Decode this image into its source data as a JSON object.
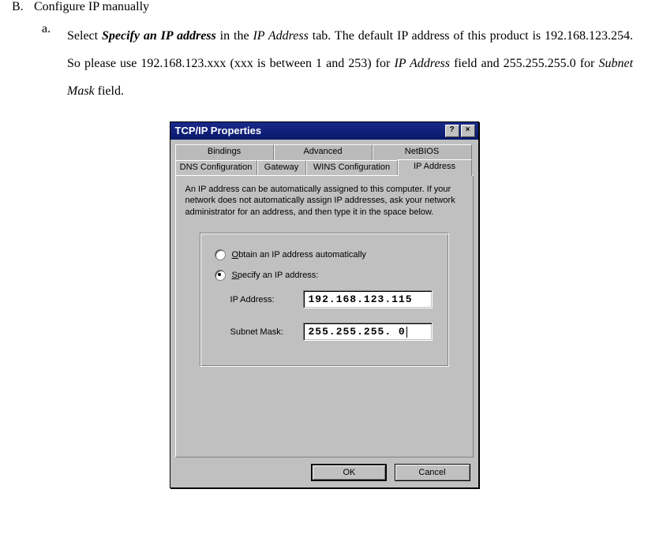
{
  "doc": {
    "section_b_marker": "B.",
    "section_b_title": "Configure IP manually",
    "sub_a_marker": "a.",
    "sub_a_pre": "Select ",
    "sub_a_strong": "Specify an IP address",
    "sub_a_mid1": " in the ",
    "sub_a_it1": "IP Address",
    "sub_a_mid2": " tab. The default IP address of this product is 192.168.123.254. So please use 192.168.123.xxx (xxx is between 1 and 253) for ",
    "sub_a_it2": "IP Address",
    "sub_a_mid3": " field and 255.255.255.0 for ",
    "sub_a_it3": "Subnet Mask",
    "sub_a_end": " field."
  },
  "dialog": {
    "title": "TCP/IP Properties",
    "help_btn": "?",
    "close_btn": "×",
    "tabs_row1": {
      "bindings": "Bindings",
      "advanced": "Advanced",
      "netbios": "NetBIOS"
    },
    "tabs_row2": {
      "dns": "DNS Configuration",
      "gateway": "Gateway",
      "wins": "WINS Configuration",
      "ip": "IP Address"
    },
    "help_text": "An IP address can be automatically assigned to this computer. If your network does not automatically assign IP addresses, ask your network administrator for an address, and then type it in the space below.",
    "radio_obtain_pre": "O",
    "radio_obtain_rest": "btain an IP address automatically",
    "radio_specify_pre": "S",
    "radio_specify_rest": "pecify an IP address:",
    "ip_label_pre": "I",
    "ip_label_rest": "P Address:",
    "subnet_label_pre": "Sub",
    "subnet_label_u": "n",
    "subnet_label_rest": "et Mask:",
    "ip_value": "192.168.123.115",
    "subnet_value": "255.255.255.  0",
    "ok": "OK",
    "cancel": "Cancel"
  }
}
